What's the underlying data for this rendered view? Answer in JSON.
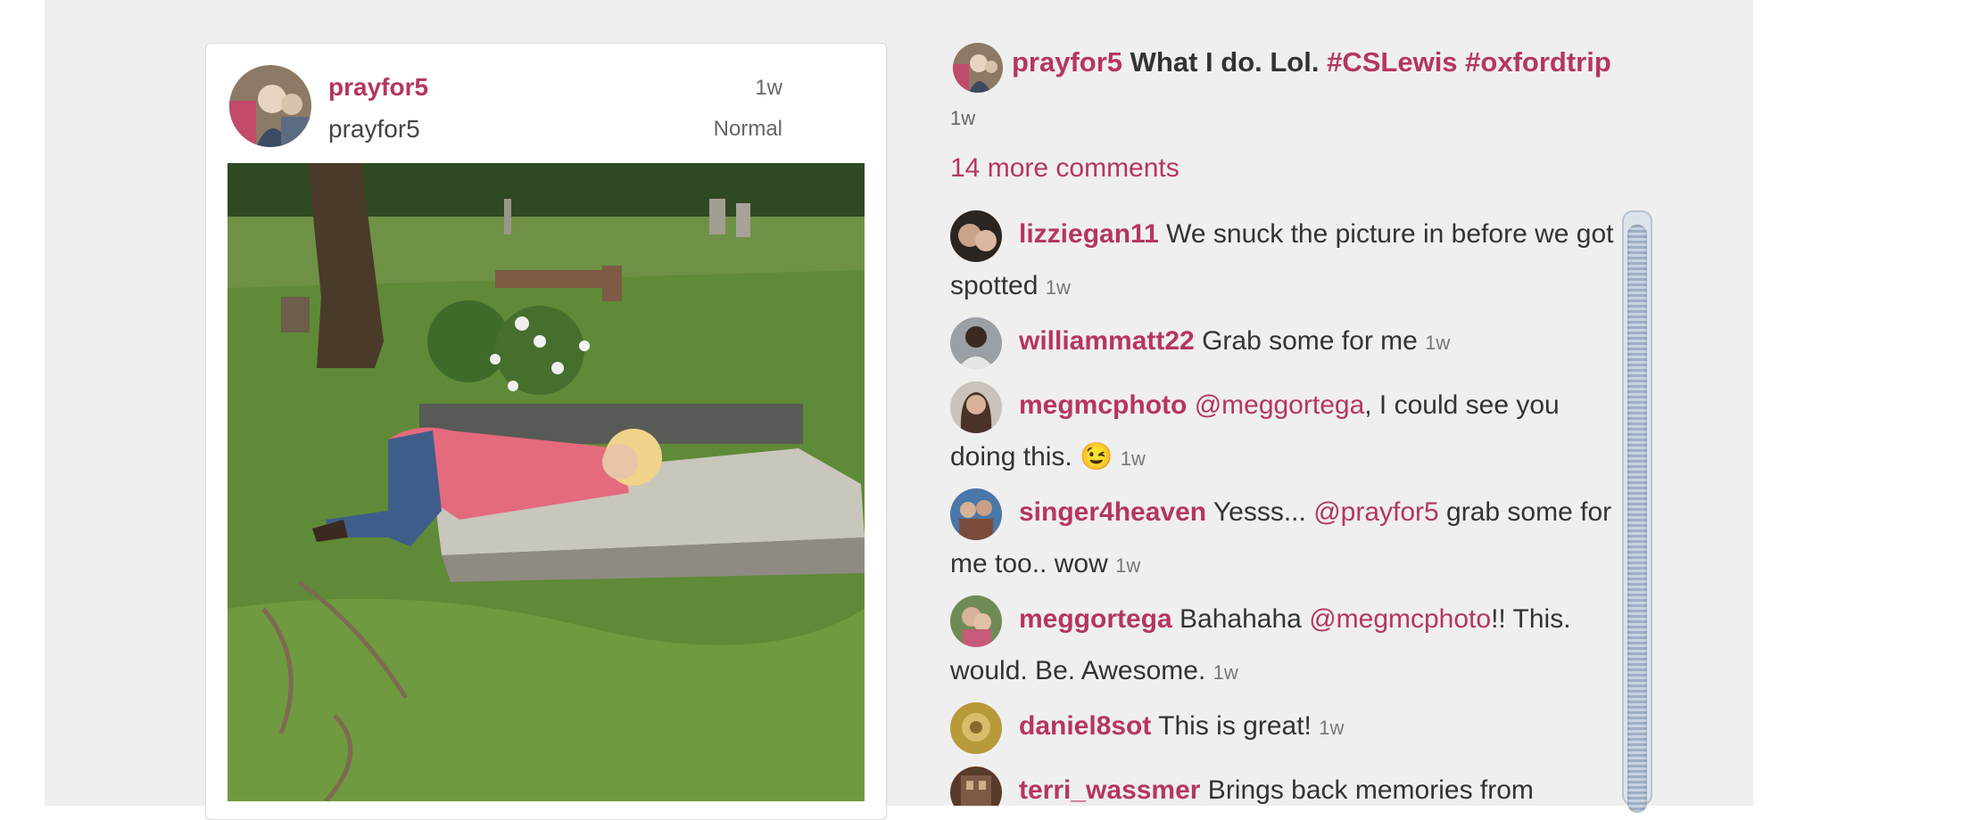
{
  "post": {
    "username": "prayfor5",
    "full_name": "prayfor5",
    "time": "1w",
    "filter": "Normal"
  },
  "caption": {
    "username": "prayfor5",
    "text": "What I do. Lol.",
    "hashtags": [
      "#CSLewis",
      "#oxfordtrip"
    ],
    "time": "1w"
  },
  "more_comments": "14 more comments",
  "comments": [
    {
      "user": "lizziegan11",
      "pre": " We snuck the picture in before we got spotted",
      "mention": "",
      "post": "",
      "time": "1w"
    },
    {
      "user": "williammatt22",
      "pre": " Grab some for me",
      "mention": "",
      "post": "",
      "time": "1w"
    },
    {
      "user": "megmcphoto",
      "pre": " ",
      "mention": "@meggortega",
      "post": ", I could see you doing this. 😉",
      "time": "1w"
    },
    {
      "user": "singer4heaven",
      "pre": " Yesss... ",
      "mention": "@prayfor5",
      "post": " grab some for me too.. wow",
      "time": "1w"
    },
    {
      "user": "meggortega",
      "pre": " Bahahaha ",
      "mention": "@megmcphoto",
      "post": "!! This. would. Be. Awesome.",
      "time": "1w"
    },
    {
      "user": "daniel8sot",
      "pre": " This is great!",
      "mention": "",
      "post": "",
      "time": "1w"
    },
    {
      "user": "terri_wassmer",
      "pre": " Brings back memories from",
      "mention": "",
      "post": "",
      "time": ""
    }
  ],
  "colors": {
    "accent": "#b5365e",
    "panel_background": "#efefef"
  }
}
